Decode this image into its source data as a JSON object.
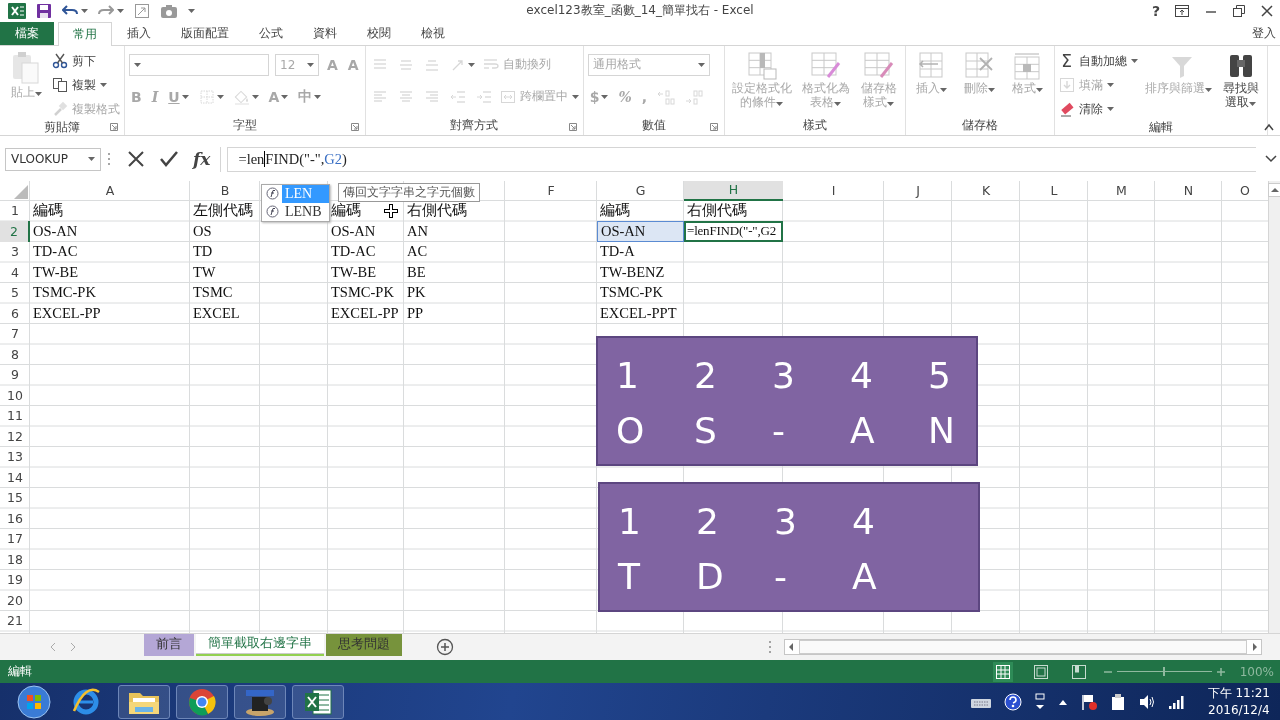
{
  "title_bar": {
    "title": "excel123教室_函數_14_簡單找右 - Excel",
    "help": "?"
  },
  "ribbon_tabs": [
    {
      "label": "檔案",
      "kind": "file",
      "selected": false
    },
    {
      "label": "常用",
      "kind": "tab",
      "selected": true
    },
    {
      "label": "插入",
      "kind": "tab",
      "selected": false
    },
    {
      "label": "版面配置",
      "kind": "tab",
      "selected": false
    },
    {
      "label": "公式",
      "kind": "tab",
      "selected": false
    },
    {
      "label": "資料",
      "kind": "tab",
      "selected": false
    },
    {
      "label": "校閱",
      "kind": "tab",
      "selected": false
    },
    {
      "label": "檢視",
      "kind": "tab",
      "selected": false
    }
  ],
  "account": "登入",
  "ribbon": {
    "groups": [
      {
        "label": "剪貼簿",
        "launcher": true,
        "items": [
          {
            "kind": "large",
            "label": "貼上",
            "menu": true,
            "disabled": true
          },
          {
            "kind": "stack",
            "items": [
              {
                "label": "剪下",
                "menu": false,
                "disabled": false
              },
              {
                "label": "複製",
                "menu": true,
                "disabled": false
              },
              {
                "label": "複製格式",
                "menu": false,
                "disabled": true
              }
            ]
          }
        ]
      },
      {
        "label": "字型",
        "launcher": true,
        "rows": [
          [
            {
              "kind": "combo-wide",
              "menu": true,
              "disabled": true
            },
            {
              "kind": "combo",
              "value": "12",
              "menu": true,
              "disabled": true
            },
            {
              "kind": "glyph",
              "text": "A",
              "menu": false,
              "disabled": true
            },
            {
              "kind": "glyph",
              "text": "A",
              "menu": false,
              "disabled": true
            }
          ],
          [
            {
              "kind": "glyph",
              "text": "B",
              "menu": false,
              "disabled": true
            },
            {
              "kind": "glyph",
              "text": "I",
              "menu": false,
              "disabled": true
            },
            {
              "kind": "glyph",
              "text": "U",
              "menu": true,
              "disabled": true
            },
            {
              "kind": "icon",
              "menu": true,
              "disabled": true
            },
            {
              "kind": "icon",
              "menu": true,
              "disabled": true
            },
            {
              "kind": "glyph",
              "text": "A",
              "menu": true,
              "disabled": true
            },
            {
              "kind": "glyph",
              "text": "中",
              "menu": true,
              "disabled": true
            }
          ]
        ]
      },
      {
        "label": "對齊方式",
        "launcher": true,
        "rows": [
          [
            {
              "kind": "icon",
              "menu": false,
              "disabled": true
            },
            {
              "kind": "icon",
              "menu": false,
              "disabled": true
            },
            {
              "kind": "icon",
              "menu": false,
              "disabled": true
            },
            {
              "kind": "icon",
              "menu": true,
              "disabled": true
            },
            {
              "kind": "small",
              "label": "自動換列",
              "menu": false,
              "disabled": true
            }
          ],
          [
            {
              "kind": "icon",
              "menu": false,
              "disabled": true
            },
            {
              "kind": "icon",
              "menu": false,
              "disabled": true
            },
            {
              "kind": "icon",
              "menu": false,
              "disabled": true
            },
            {
              "kind": "icon",
              "menu": false,
              "disabled": true
            },
            {
              "kind": "icon",
              "menu": false,
              "disabled": true
            },
            {
              "kind": "small",
              "label": "跨欄置中",
              "menu": true,
              "disabled": true
            }
          ]
        ]
      },
      {
        "label": "數值",
        "launcher": true,
        "rows": [
          [
            {
              "kind": "combo-wide",
              "value": "通用格式",
              "menu": true,
              "disabled": true
            }
          ],
          [
            {
              "kind": "glyph",
              "text": "$",
              "menu": true,
              "disabled": true
            },
            {
              "kind": "glyph",
              "text": "%",
              "menu": false,
              "disabled": true
            },
            {
              "kind": "glyph",
              "text": ",",
              "menu": false,
              "disabled": true
            },
            {
              "kind": "icon",
              "menu": false,
              "disabled": true
            },
            {
              "kind": "icon",
              "menu": false,
              "disabled": true
            }
          ]
        ]
      },
      {
        "label": "樣式",
        "launcher": false,
        "items": [
          {
            "kind": "large",
            "lines": [
              "設定格式化",
              "的條件"
            ],
            "menu": true,
            "disabled": true
          },
          {
            "kind": "large",
            "lines": [
              "格式化為",
              "表格"
            ],
            "menu": true,
            "disabled": true
          },
          {
            "kind": "large",
            "lines": [
              "儲存格",
              "樣式"
            ],
            "menu": true,
            "disabled": true
          }
        ]
      },
      {
        "label": "儲存格",
        "launcher": false,
        "items": [
          {
            "kind": "large",
            "label": "插入",
            "menu": true,
            "disabled": true
          },
          {
            "kind": "large",
            "label": "刪除",
            "menu": true,
            "disabled": true
          },
          {
            "kind": "large",
            "label": "格式",
            "menu": true,
            "disabled": true
          }
        ]
      },
      {
        "label": "編輯",
        "launcher": false,
        "items": [
          {
            "kind": "stack",
            "items": [
              {
                "label": "自動加總",
                "glyph": "Σ",
                "menu": true,
                "disabled": false
              },
              {
                "label": "填滿",
                "menu": true,
                "disabled": true
              },
              {
                "label": "清除",
                "menu": true,
                "disabled": false
              }
            ]
          },
          {
            "kind": "large",
            "label": "排序與篩選",
            "menu": true,
            "disabled": true
          },
          {
            "kind": "large",
            "lines": [
              "尋找與",
              "選取"
            ],
            "menu": true,
            "disabled": false
          }
        ]
      }
    ]
  },
  "formula_bar": {
    "name_box": "VLOOKUP",
    "fx": "fx",
    "parts": [
      {
        "kind": "text",
        "text": "=len"
      },
      {
        "kind": "caret"
      },
      {
        "kind": "text",
        "text": "FIND(\"-\","
      },
      {
        "kind": "reference",
        "text": "G2"
      },
      {
        "kind": "text",
        "text": ")"
      }
    ]
  },
  "columns": [
    {
      "header": "A",
      "selected": false
    },
    {
      "header": "B",
      "selected": false
    },
    {},
    {},
    {},
    {
      "header": "F",
      "selected": false
    },
    {
      "header": "G",
      "selected": false
    },
    {
      "header": "H",
      "selected": true
    },
    {
      "header": "I",
      "selected": false
    },
    {
      "header": "J",
      "selected": false
    },
    {
      "header": "K",
      "selected": false
    },
    {
      "header": "L",
      "selected": false
    },
    {
      "header": "M",
      "selected": false
    },
    {
      "header": "N",
      "selected": false
    },
    {
      "header": "O",
      "selected": false
    }
  ],
  "rows": [
    {
      "number": "1",
      "selected": false,
      "cells": {
        "A": "編碼",
        "B": "左側代碼",
        "D": "編碼",
        "E": "右側代碼",
        "G": "編碼",
        "H": "右側代碼"
      }
    },
    {
      "number": "2",
      "selected": true,
      "cells": {
        "A": "OS-AN",
        "B": "OS",
        "D": "OS-AN",
        "E": "AN",
        "G": {
          "text": "OS-AN",
          "referenced": true,
          "selected": false
        },
        "H": {
          "text": "=lenFIND(\"-\",G2",
          "referenced": false,
          "selected": true
        }
      }
    },
    {
      "number": "3",
      "selected": false,
      "cells": {
        "A": "TD-AC",
        "B": "TD",
        "D": "TD-AC",
        "E": "AC",
        "G": "TD-A"
      }
    },
    {
      "number": "4",
      "selected": false,
      "cells": {
        "A": "TW-BE",
        "B": "TW",
        "D": "TW-BE",
        "E": "BE",
        "G": "TW-BENZ"
      }
    },
    {
      "number": "5",
      "selected": false,
      "cells": {
        "A": "TSMC-PK",
        "B": "TSMC",
        "D": "TSMC-PK",
        "E": "PK",
        "G": "TSMC-PK"
      }
    },
    {
      "number": "6",
      "selected": false,
      "cells": {
        "A": "EXCEL-PP",
        "B": "EXCEL",
        "D": "EXCEL-PP",
        "E": "PP",
        "G": "EXCEL-PPT"
      }
    },
    {
      "number": "7",
      "selected": false
    },
    {
      "number": "8",
      "selected": false
    },
    {
      "number": "9",
      "selected": false
    },
    {
      "number": "10",
      "selected": false
    },
    {
      "number": "11",
      "selected": false
    },
    {
      "number": "12",
      "selected": false
    },
    {
      "number": "13",
      "selected": false
    },
    {
      "number": "14",
      "selected": false
    },
    {
      "number": "15",
      "selected": false
    },
    {
      "number": "16",
      "selected": false
    },
    {
      "number": "17",
      "selected": false
    },
    {
      "number": "18",
      "selected": false
    },
    {
      "number": "19",
      "selected": false
    },
    {
      "number": "20",
      "selected": false
    },
    {
      "number": "21",
      "selected": false
    }
  ],
  "autocomplete": {
    "items": [
      {
        "label": "LEN",
        "selected": true
      },
      {
        "label": "LENB",
        "selected": false
      }
    ],
    "tooltip": "傳回文字字串之字元個數"
  },
  "shapes": [
    {
      "rows": [
        [
          "1",
          "2",
          "3",
          "4",
          "5"
        ],
        [
          "O",
          "S",
          "-",
          "A",
          "N"
        ]
      ]
    },
    {
      "rows": [
        [
          "1",
          "2",
          "3",
          "4"
        ],
        [
          "T",
          "D",
          "-",
          "A"
        ]
      ]
    }
  ],
  "sheet_tabs": [
    {
      "label": "前言",
      "selected": false,
      "color": "#b4a7d6"
    },
    {
      "label": "簡單截取右邊字串",
      "selected": true,
      "color": "#92d050"
    },
    {
      "label": "思考問題",
      "selected": false,
      "color": "#77933c"
    }
  ],
  "status_bar": {
    "mode": "編輯",
    "views": [
      {
        "selected": true
      },
      {
        "selected": false
      },
      {
        "selected": false
      }
    ],
    "zoom_slider": {
      "level": 0.5
    },
    "zoom": "100%"
  },
  "taskbar": {
    "apps": [
      {
        "kind": "browser-e",
        "running": false
      },
      {
        "kind": "folder",
        "running": true
      },
      {
        "kind": "browser-ring",
        "running": true
      },
      {
        "kind": "camera",
        "running": true
      },
      {
        "kind": "spreadsheet",
        "running": true
      }
    ],
    "time": "下午 11:21",
    "date": "2016/12/4"
  }
}
